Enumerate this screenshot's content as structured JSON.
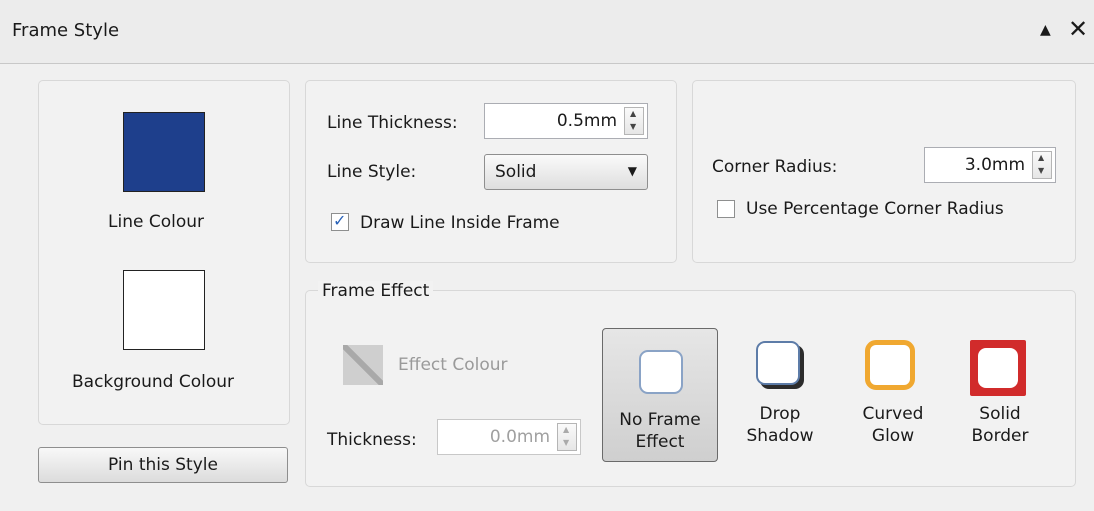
{
  "panel": {
    "title": "Frame Style",
    "collapse_icon": "▲",
    "close_icon": "✕"
  },
  "colours": {
    "line_colour_label": "Line Colour",
    "line_colour_value": "#1e3f8c",
    "background_colour_label": "Background Colour",
    "background_colour_value": "#ffffff"
  },
  "pin_button_label": "Pin this Style",
  "line": {
    "thickness_label": "Line Thickness:",
    "thickness_value": "0.5mm",
    "style_label": "Line Style:",
    "style_value": "Solid",
    "draw_inside_label": "Draw Line Inside Frame",
    "draw_inside_checked": true
  },
  "corner": {
    "radius_label": "Corner Radius:",
    "radius_value": "3.0mm",
    "use_percentage_label": "Use Percentage Corner Radius",
    "use_percentage_checked": false
  },
  "frame_effect": {
    "group_label": "Frame Effect",
    "effect_colour_label": "Effect Colour",
    "thickness_label": "Thickness:",
    "thickness_value": "0.0mm",
    "effects": [
      {
        "line1": "No Frame",
        "line2": "Effect",
        "selected": true
      },
      {
        "line1": "Drop",
        "line2": "Shadow",
        "selected": false
      },
      {
        "line1": "Curved",
        "line2": "Glow",
        "selected": false,
        "color": "#f0a830"
      },
      {
        "line1": "Solid",
        "line2": "Border",
        "selected": false,
        "color": "#d12b2b"
      }
    ]
  }
}
